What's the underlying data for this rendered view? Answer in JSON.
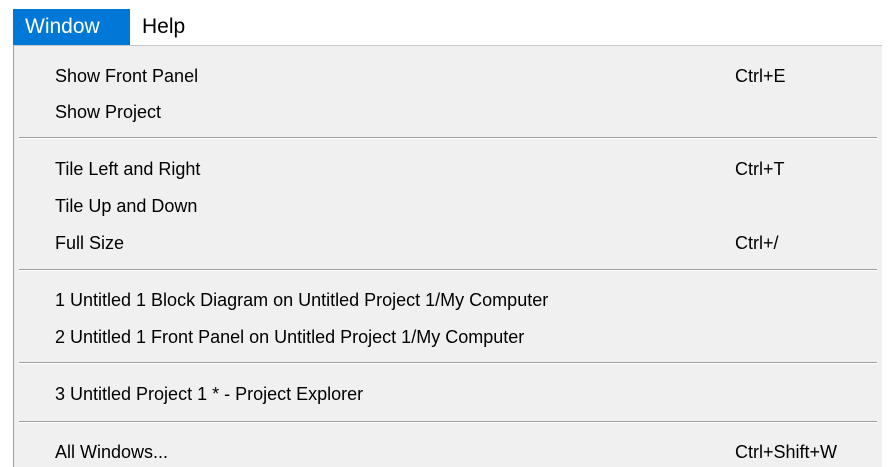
{
  "menubar": {
    "items": [
      {
        "label": "Window"
      },
      {
        "label": "Help"
      }
    ]
  },
  "window_menu": {
    "items": [
      {
        "label": "Show Front Panel",
        "shortcut": "Ctrl+E"
      },
      {
        "label": "Show Project",
        "shortcut": ""
      },
      {
        "label": "Tile Left and Right",
        "shortcut": "Ctrl+T"
      },
      {
        "label": "Tile Up and Down",
        "shortcut": ""
      },
      {
        "label": "Full Size",
        "shortcut": "Ctrl+/"
      },
      {
        "label": "1 Untitled 1 Block Diagram on Untitled Project 1/My Computer",
        "shortcut": ""
      },
      {
        "label": "2 Untitled 1 Front Panel on Untitled Project 1/My Computer",
        "shortcut": ""
      },
      {
        "label": "3 Untitled Project 1 * - Project Explorer",
        "shortcut": ""
      },
      {
        "label": "All Windows...",
        "shortcut": "Ctrl+Shift+W"
      }
    ]
  },
  "colors": {
    "active_menu_bg": "#0078d7",
    "active_menu_text": "#ffffff",
    "dropdown_bg": "#f0f0f0",
    "separator": "#a0a0a0"
  }
}
